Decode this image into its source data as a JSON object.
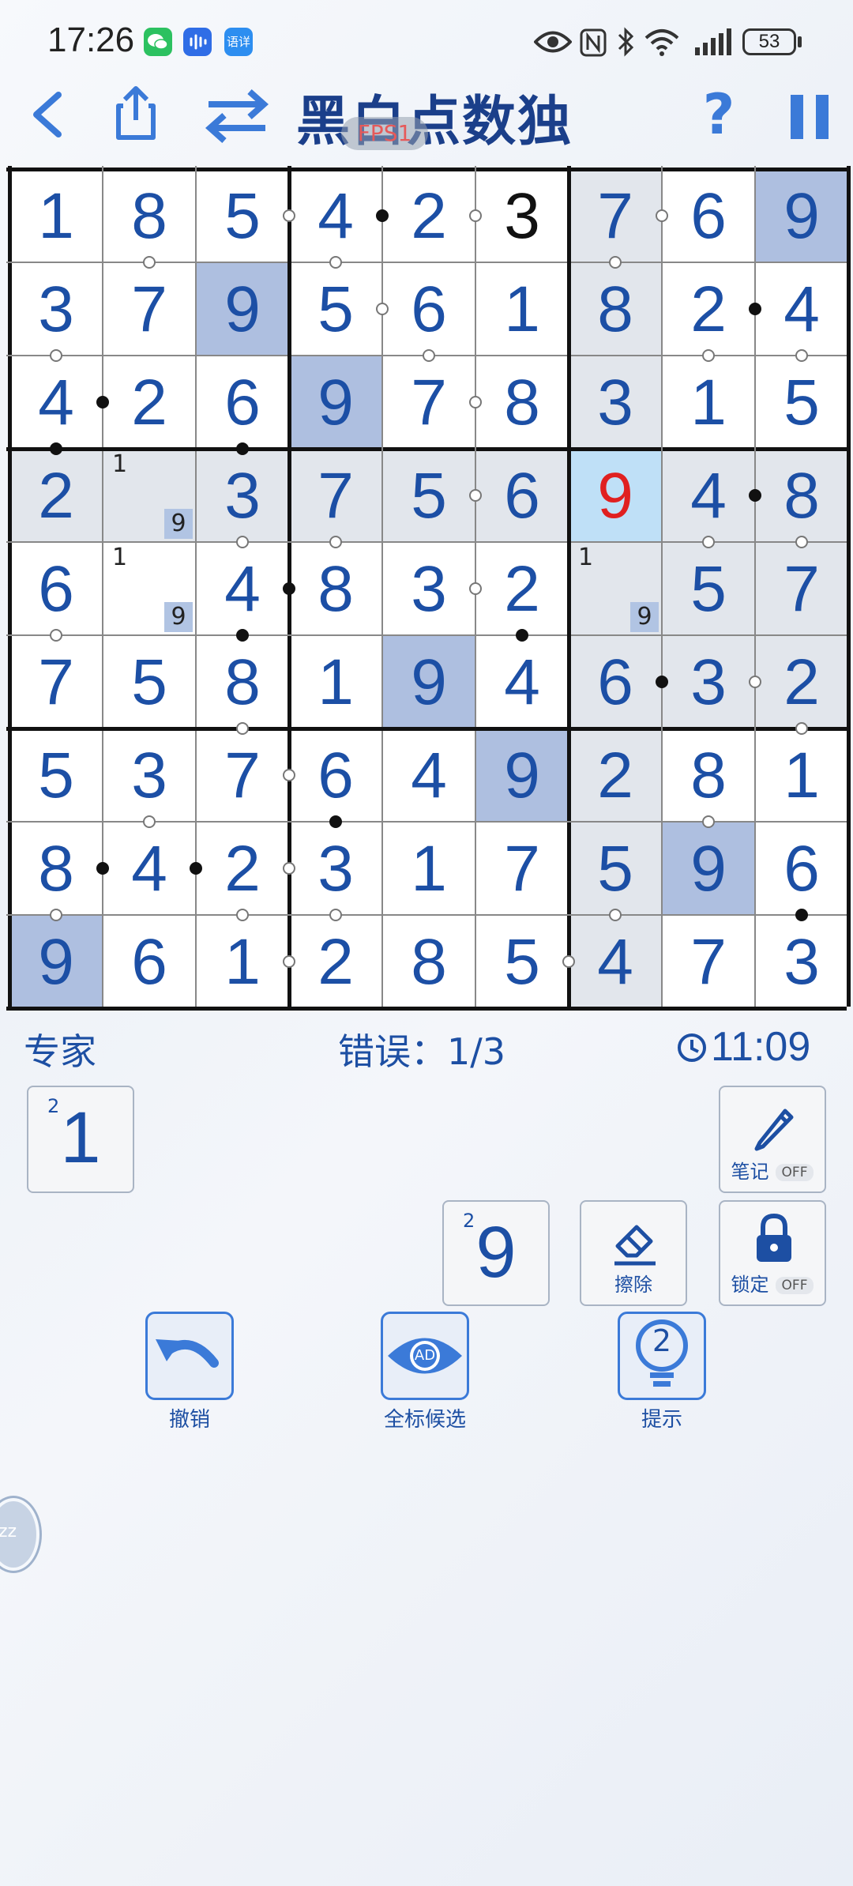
{
  "status_bar": {
    "time": "17:26",
    "battery": "53",
    "app_badge": "语详"
  },
  "header": {
    "title": "黑白点数独",
    "fps": "FPS1",
    "help": "?"
  },
  "grid": {
    "values": [
      [
        "1",
        "8",
        "5",
        "4",
        "2",
        "3",
        "7",
        "6",
        "9"
      ],
      [
        "3",
        "7",
        "9",
        "5",
        "6",
        "1",
        "8",
        "2",
        "4"
      ],
      [
        "4",
        "2",
        "6",
        "9",
        "7",
        "8",
        "3",
        "1",
        "5"
      ],
      [
        "2",
        "",
        "3",
        "7",
        "5",
        "6",
        "9",
        "4",
        "8"
      ],
      [
        "6",
        "",
        "4",
        "8",
        "3",
        "2",
        "",
        "5",
        "7"
      ],
      [
        "7",
        "5",
        "8",
        "1",
        "9",
        "4",
        "6",
        "3",
        "2"
      ],
      [
        "5",
        "3",
        "7",
        "6",
        "4",
        "9",
        "2",
        "8",
        "1"
      ],
      [
        "8",
        "4",
        "2",
        "3",
        "1",
        "7",
        "5",
        "9",
        "6"
      ],
      [
        "9",
        "6",
        "1",
        "2",
        "8",
        "5",
        "4",
        "7",
        "3"
      ]
    ],
    "given_black": [
      [
        0,
        5
      ]
    ],
    "error_red": [
      [
        3,
        6
      ]
    ],
    "candidates": [
      {
        "r": 3,
        "c": 1,
        "digits": [
          "1",
          "9"
        ]
      },
      {
        "r": 4,
        "c": 1,
        "digits": [
          "1",
          "9"
        ]
      },
      {
        "r": 4,
        "c": 6,
        "digits": [
          "1",
          "9"
        ]
      }
    ],
    "colors": {
      "highlight_9": "#aebfe0",
      "selected": "#bfe0f7",
      "related": "#e2e6ec",
      "cell": "#ffffff",
      "digit": "#1c4fa5",
      "error": "#e02020",
      "given": "#111111"
    }
  },
  "info": {
    "difficulty": "专家",
    "errors": "错误：1/3",
    "timer": "11:09"
  },
  "number_tiles": [
    {
      "count": "2",
      "digit": "1"
    },
    {
      "count": "2",
      "digit": "9"
    }
  ],
  "tools": {
    "notes": "笔记",
    "notes_state": "OFF",
    "erase": "擦除",
    "lock": "锁定",
    "lock_state": "OFF"
  },
  "actions": {
    "undo": "撤销",
    "show_candidates": "全标候选",
    "show_candidates_badge": "AD",
    "hint": "提示",
    "hint_count": "2"
  },
  "floating": {
    "label": "zz"
  }
}
